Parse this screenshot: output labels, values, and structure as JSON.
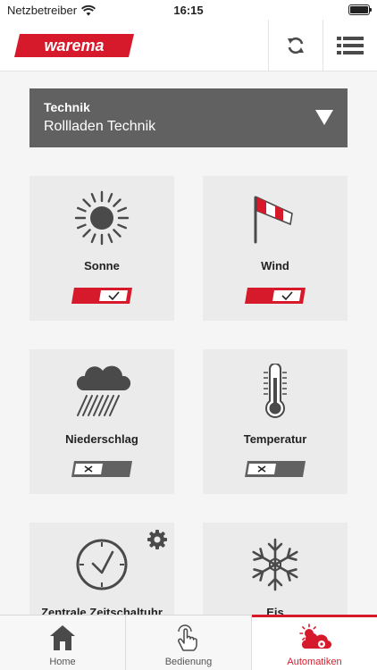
{
  "status_bar": {
    "carrier": "Netzbetreiber",
    "time": "16:15"
  },
  "header": {
    "logo_text": "warema",
    "logo_color": "#d71a2b"
  },
  "device_selector": {
    "label": "Technik",
    "value": "Rollladen Technik"
  },
  "tiles": [
    {
      "label": "Sonne",
      "icon": "sun-icon",
      "enabled": true
    },
    {
      "label": "Wind",
      "icon": "windsock-icon",
      "enabled": true
    },
    {
      "label": "Niederschlag",
      "icon": "rain-icon",
      "enabled": false
    },
    {
      "label": "Temperatur",
      "icon": "thermometer-icon",
      "enabled": false
    },
    {
      "label": "Zentrale Zeitschaltuhr",
      "icon": "clock-icon",
      "has_settings": true
    },
    {
      "label": "Eis",
      "icon": "snowflake-icon"
    }
  ],
  "tabs": [
    {
      "label": "Home",
      "icon": "home-icon",
      "active": false
    },
    {
      "label": "Bedienung",
      "icon": "hand-tap-icon",
      "active": false
    },
    {
      "label": "Automatiken",
      "icon": "weather-gear-icon",
      "active": true
    }
  ],
  "colors": {
    "accent": "#d71a2b",
    "toggle_off": "#616161",
    "tile_bg": "#ebebeb",
    "selector_bg": "#616161"
  }
}
